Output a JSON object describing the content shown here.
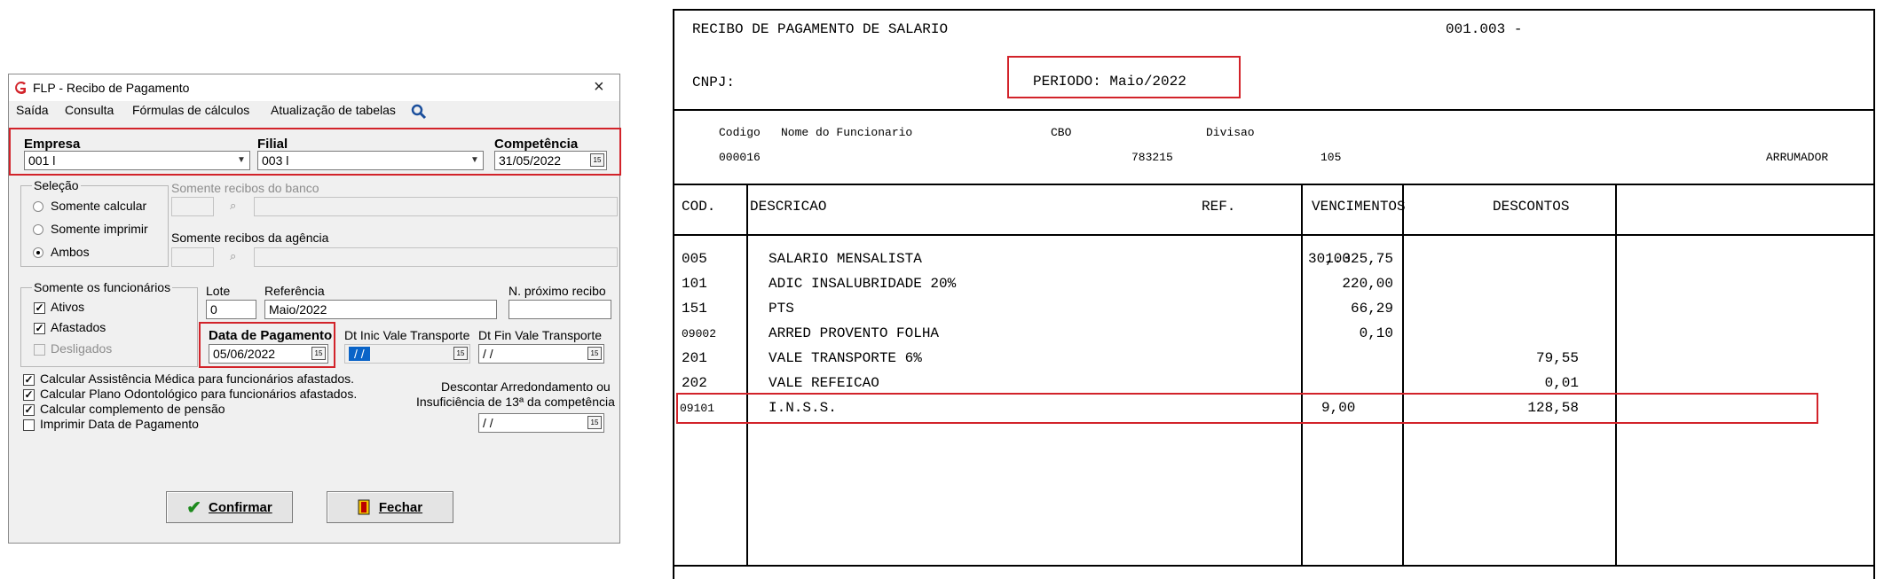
{
  "dialog": {
    "title": "FLP - Recibo de Pagamento",
    "menu": [
      "Saída",
      "Consulta",
      "Fórmulas de cálculos",
      "Atualização de tabelas"
    ],
    "empresa_label": "Empresa",
    "empresa_value": "001 l",
    "filial_label": "Filial",
    "filial_value": "003 l",
    "competencia_label": "Competência",
    "competencia_value": "31/05/2022",
    "selecao_label": "Seleção",
    "selecao_options": [
      "Somente calcular",
      "Somente imprimir",
      "Ambos"
    ],
    "selecao_selected": "Ambos",
    "somente_recibos_banco_label": "Somente recibos do banco",
    "somente_recibos_agencia_label": "Somente recibos da agência",
    "funcionarios_label": "Somente os funcionários",
    "funcionarios_options": [
      {
        "label": "Ativos",
        "checked": true,
        "enabled": true
      },
      {
        "label": "Afastados",
        "checked": true,
        "enabled": true
      },
      {
        "label": "Desligados",
        "checked": false,
        "enabled": false
      }
    ],
    "lote_label": "Lote",
    "lote_value": "0",
    "referencia_label": "Referência",
    "referencia_value": "Maio/2022",
    "proximo_recibo_label": "N. próximo recibo",
    "data_pagamento_label": "Data de Pagamento",
    "data_pagamento_value": "05/06/2022",
    "dt_inic_vt_label": "Dt Inic Vale Transporte",
    "dt_inic_vt_value": " / /",
    "dt_fin_vt_label": "Dt Fin Vale Transporte",
    "dt_fin_vt_value": " / /",
    "options": [
      {
        "label": "Calcular Assistência Médica para funcionários afastados.",
        "checked": true
      },
      {
        "label": "Calcular Plano Odontológico para funcionários afastados.",
        "checked": true
      },
      {
        "label": "Calcular complemento de pensão",
        "checked": true
      },
      {
        "label": "Imprimir Data de Pagamento",
        "checked": false
      }
    ],
    "descontar_line1": "Descontar Arredondamento ou",
    "descontar_line2": "Insuficiência de 13ª da competência",
    "descontar_value": " / /",
    "confirm_label": "Confirmar",
    "close_label": "Fechar",
    "calendar_glyph": "15"
  },
  "receipt": {
    "title": "RECIBO DE PAGAMENTO DE SALARIO",
    "code": "001.003 -",
    "cnpj_label": "CNPJ:",
    "periodo": "PERIODO: Maio/2022",
    "emp_headers": {
      "codigo": "Codigo",
      "nome": "Nome do Funcionario",
      "cbo": "CBO",
      "divisao": "Divisao"
    },
    "emp_values": {
      "codigo": "000016",
      "cbo": "783215",
      "divisao": "105",
      "funcao": "ARRUMADOR"
    },
    "col_headers": {
      "cod": "COD.",
      "descricao": "DESCRICAO",
      "ref": "REF.",
      "vencimentos": "VENCIMENTOS",
      "descontos": "DESCONTOS"
    },
    "rows": [
      {
        "cod": "005",
        "desc": "SALARIO MENSALISTA",
        "ref": "30,00",
        "venc": "1.325,75",
        "desc_val": ""
      },
      {
        "cod": "101",
        "desc": "ADIC INSALUBRIDADE 20%",
        "ref": "",
        "venc": "220,00",
        "desc_val": ""
      },
      {
        "cod": "151",
        "desc": "PTS",
        "ref": "",
        "venc": "66,29",
        "desc_val": ""
      },
      {
        "cod": "09002",
        "desc": "ARRED PROVENTO FOLHA",
        "ref": "",
        "venc": "0,10",
        "desc_val": ""
      },
      {
        "cod": "201",
        "desc": "VALE TRANSPORTE 6%",
        "ref": "",
        "venc": "",
        "desc_val": "79,55"
      },
      {
        "cod": "202",
        "desc": "VALE REFEICAO",
        "ref": "",
        "venc": "",
        "desc_val": "0,01"
      },
      {
        "cod": "09101",
        "desc": "I.N.S.S.",
        "ref": "9,00",
        "venc": "",
        "desc_val": "128,58"
      }
    ]
  }
}
